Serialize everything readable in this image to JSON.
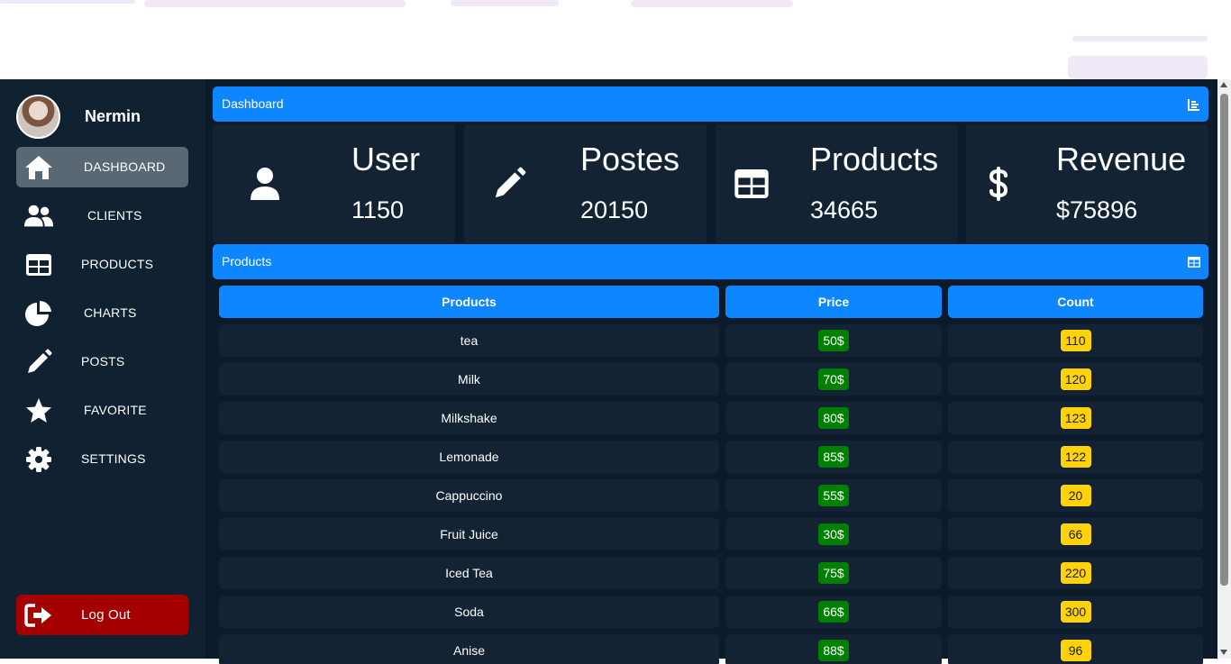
{
  "user": {
    "name": "Nermin"
  },
  "sidebar": {
    "items": [
      {
        "label": "DASHBOARD",
        "icon": "home-icon",
        "active": true
      },
      {
        "label": "CLIENTS",
        "icon": "users-icon",
        "active": false
      },
      {
        "label": "PRODUCTS",
        "icon": "table-icon",
        "active": false
      },
      {
        "label": "CHARTS",
        "icon": "pie-chart-icon",
        "active": false
      },
      {
        "label": "POSTS",
        "icon": "pencil-icon",
        "active": false
      },
      {
        "label": "FAVORITE",
        "icon": "star-icon",
        "active": false
      },
      {
        "label": "SETTINGS",
        "icon": "gear-icon",
        "active": false
      }
    ],
    "logout_label": "Log Out"
  },
  "dashboard": {
    "header": "Dashboard",
    "cards": [
      {
        "title": "User",
        "value": "1150",
        "icon": "user-icon"
      },
      {
        "title": "Postes",
        "value": "20150",
        "icon": "pencil-icon"
      },
      {
        "title": "Products",
        "value": "34665",
        "icon": "table-icon"
      },
      {
        "title": "Revenue",
        "value": "$75896",
        "icon": "dollar-icon"
      }
    ]
  },
  "products": {
    "header": "Products",
    "columns": [
      "Products",
      "Price",
      "Count"
    ],
    "rows": [
      {
        "name": "tea",
        "price": "50$",
        "count": "110"
      },
      {
        "name": "Milk",
        "price": "70$",
        "count": "120"
      },
      {
        "name": "Milkshake",
        "price": "80$",
        "count": "123"
      },
      {
        "name": "Lemonade",
        "price": "85$",
        "count": "122"
      },
      {
        "name": "Cappuccino",
        "price": "55$",
        "count": "20"
      },
      {
        "name": "Fruit Juice",
        "price": "30$",
        "count": "66"
      },
      {
        "name": "Iced Tea",
        "price": "75$",
        "count": "220"
      },
      {
        "name": "Soda",
        "price": "66$",
        "count": "300"
      },
      {
        "name": "Anise",
        "price": "88$",
        "count": "96"
      }
    ]
  },
  "colors": {
    "accent": "#0d86ff",
    "sidebar_bg": "#102132",
    "main_bg": "#0c1b2a",
    "card_bg": "#142334",
    "price_badge": "#008000",
    "count_badge": "#ffd20a",
    "logout": "#a40000"
  }
}
